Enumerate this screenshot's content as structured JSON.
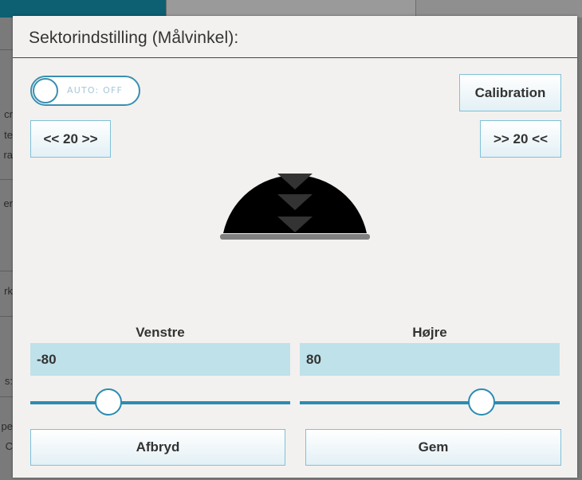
{
  "dialog": {
    "title": "Sektorindstilling (Målvinkel):"
  },
  "toggle": {
    "label": "AUTO: OFF",
    "state": "off"
  },
  "buttons": {
    "calibration": "Calibration",
    "step_left": "<< 20 >>",
    "step_right": ">> 20 <<",
    "cancel": "Afbryd",
    "save": "Gem"
  },
  "left": {
    "label": "Venstre",
    "value": "-80",
    "slider_fraction": 0.3
  },
  "right": {
    "label": "Højre",
    "value": "80",
    "slider_fraction": 0.7
  },
  "background": {
    "fragments": [
      "cr",
      "te",
      "ra",
      "er",
      "rk",
      "s:",
      "pe",
      "C"
    ]
  },
  "colors": {
    "accent": "#2a8cb0",
    "field_bg": "#bfe1ea",
    "dialog_bg": "#f2f1ef"
  }
}
